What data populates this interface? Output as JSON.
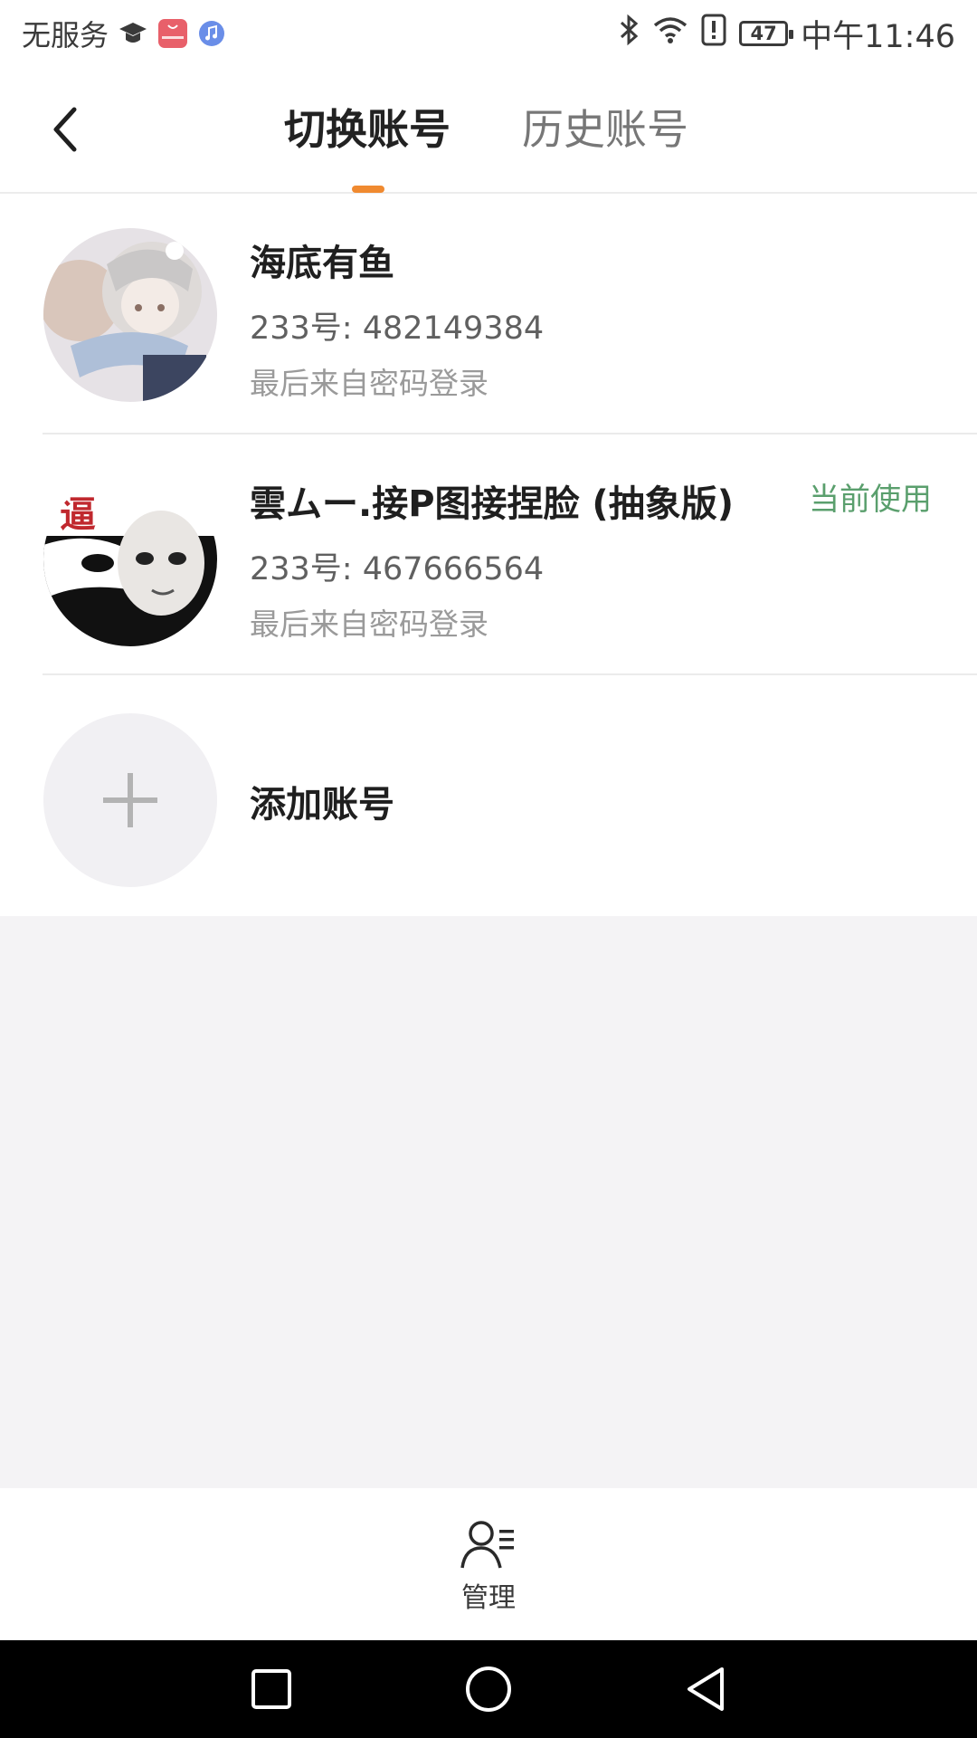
{
  "status_bar": {
    "carrier": "无服务",
    "time": "中午11:46",
    "battery": "47",
    "icons": [
      "graduation-cap-icon",
      "huawei-app-icon",
      "music-icon",
      "bluetooth-icon",
      "wifi-icon",
      "alert-icon",
      "battery-icon"
    ]
  },
  "header": {
    "back_icon": "chevron-left-icon",
    "tabs": [
      {
        "label": "切换账号",
        "active": true
      },
      {
        "label": "历史账号",
        "active": false
      }
    ],
    "indicator_color": "#f08a30"
  },
  "accounts": [
    {
      "name": "海底有鱼",
      "uid": "233号: 482149384",
      "last_login": "最后来自密码登录"
    },
    {
      "name": "雲ムー.接P图接捏脸 (抽象版)",
      "uid": "233号: 467666564",
      "last_login": "最后来自密码登录",
      "status": "当前使用",
      "avatar_text": "逼"
    }
  ],
  "add_account": {
    "label": "添加账号"
  },
  "bottom": {
    "manage_label": "管理",
    "icon": "user-list-icon"
  },
  "nav": {
    "icons": [
      "square-icon",
      "circle-icon",
      "triangle-back-icon"
    ]
  },
  "colors": {
    "accent": "#f08a30",
    "current_green": "#5a9f6d",
    "background": "#f4f3f5"
  }
}
